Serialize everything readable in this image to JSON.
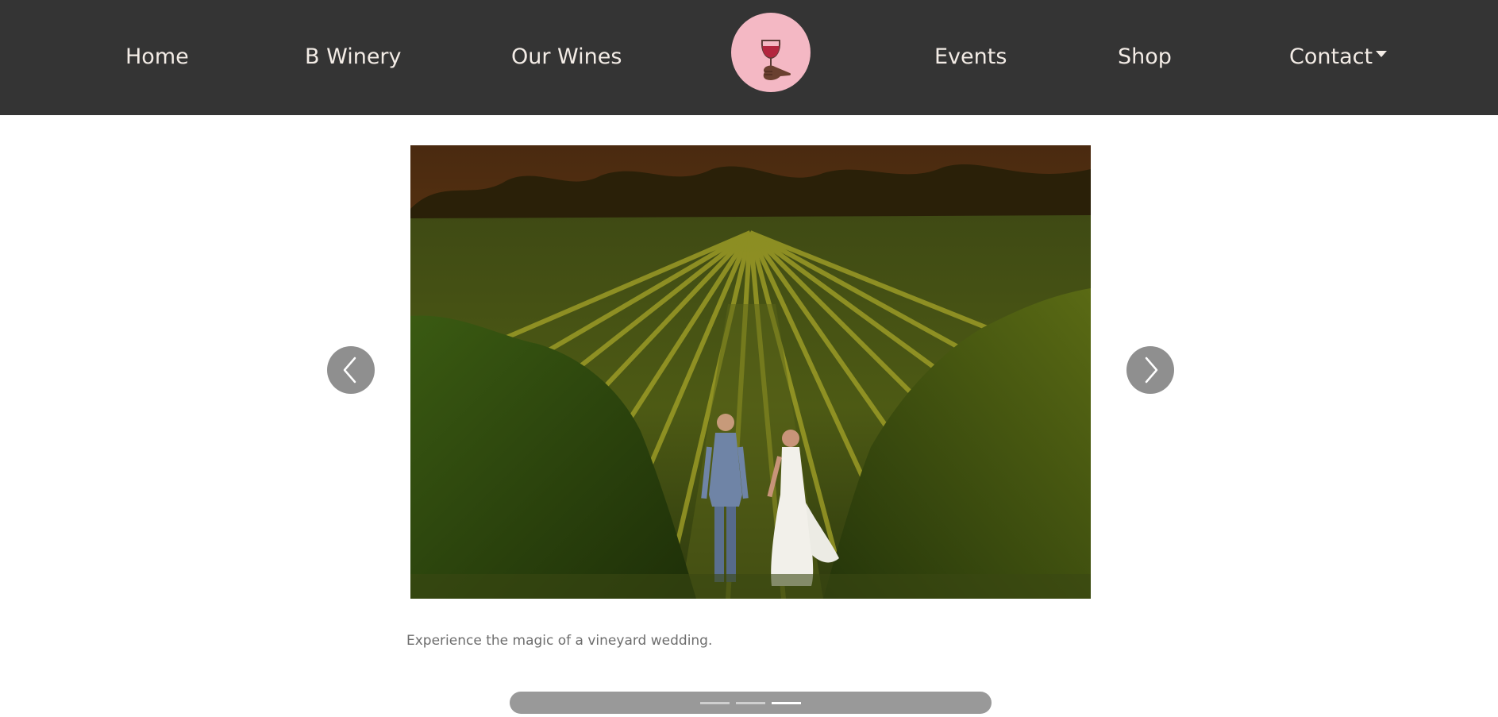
{
  "nav": {
    "left_items": [
      "Home",
      "B Winery",
      "Our Wines"
    ],
    "right_items": [
      "Events",
      "Shop"
    ],
    "dropdown_label": "Contact",
    "logo_icon": "wine-glass-in-hand-icon"
  },
  "carousel": {
    "caption": "Experience the magic of a vineyard wedding.",
    "prev_icon": "chevron-left-icon",
    "next_icon": "chevron-right-icon",
    "slide_count": 3,
    "active_index": 2
  },
  "colors": {
    "navbar": "#343434",
    "nav_text": "#f3ece6",
    "logo_bg": "#f4b8c4",
    "wine": "#b3263f"
  }
}
